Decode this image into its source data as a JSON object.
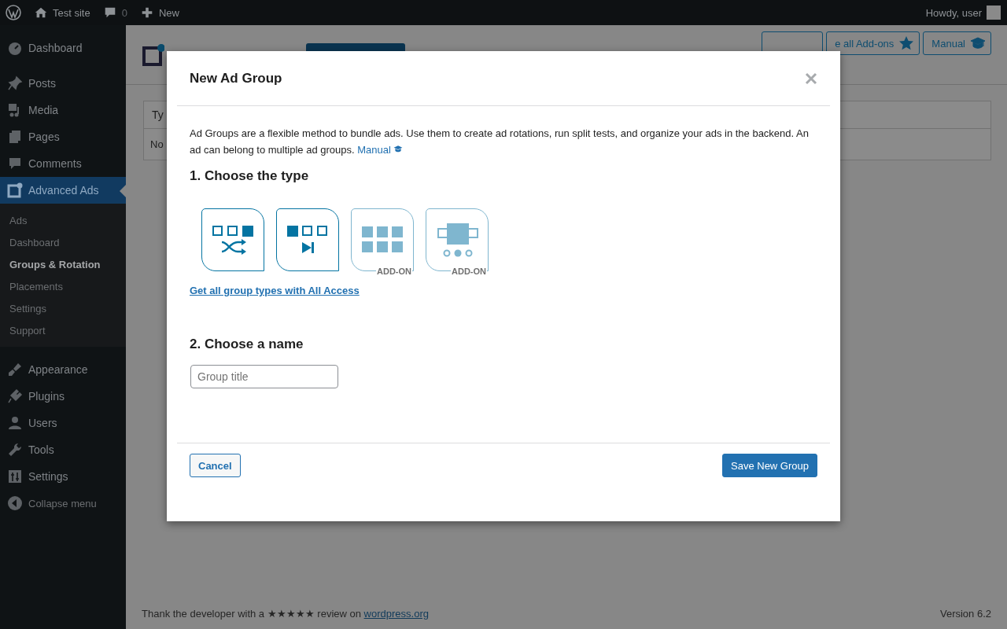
{
  "admin_bar": {
    "site": "Test site",
    "comments": "0",
    "new": "New",
    "greeting": "Howdy, user"
  },
  "menu": {
    "items": [
      {
        "label": "Dashboard",
        "selected": false
      },
      {
        "label": "Posts",
        "selected": false
      },
      {
        "label": "Media",
        "selected": false
      },
      {
        "label": "Pages",
        "selected": false
      },
      {
        "label": "Comments",
        "selected": false
      },
      {
        "label": "Advanced Ads",
        "selected": true,
        "children": [
          {
            "label": "Ads",
            "selected": false
          },
          {
            "label": "Dashboard",
            "selected": false
          },
          {
            "label": "Groups & Rotation",
            "selected": true
          },
          {
            "label": "Placements",
            "selected": false
          },
          {
            "label": "Settings",
            "selected": false
          },
          {
            "label": "Support",
            "selected": false
          }
        ]
      },
      {
        "label": "Appearance",
        "selected": false
      },
      {
        "label": "Plugins",
        "selected": false
      },
      {
        "label": "Users",
        "selected": false
      },
      {
        "label": "Tools",
        "selected": false
      },
      {
        "label": "Settings",
        "selected": false
      }
    ],
    "collapse": "Collapse menu"
  },
  "page": {
    "header_buttons": [
      "e all Add-ons",
      "Manual"
    ],
    "table": {
      "columns": [
        "Ty"
      ],
      "rows": [
        [
          "No"
        ]
      ]
    }
  },
  "modal": {
    "title": "New Ad Group",
    "description": "Ad Groups are a flexible method to bundle ads. Use them to create ad rotations, run split tests, and organize your ads in the backend. An ad can belong to multiple ad groups.",
    "manual_link": "Manual",
    "type_heading": "1. Choose the type",
    "types": [
      {
        "kind": "random",
        "disabled": false
      },
      {
        "kind": "ordered",
        "disabled": false
      },
      {
        "kind": "grid",
        "disabled": true,
        "badge": "ADD-ON"
      },
      {
        "kind": "slider",
        "disabled": true,
        "badge": "ADD-ON"
      }
    ],
    "all_access_link": "Get all group types with All Access",
    "name_heading": "2. Choose a name",
    "name_field": {
      "placeholder": "Group title"
    },
    "cancel": "Cancel",
    "save": "Save New Group"
  },
  "footer": {
    "thanks": "Thank the developer with a ★★★★★ review on",
    "link": "wordpress.org",
    "version": "Version 6.2"
  }
}
